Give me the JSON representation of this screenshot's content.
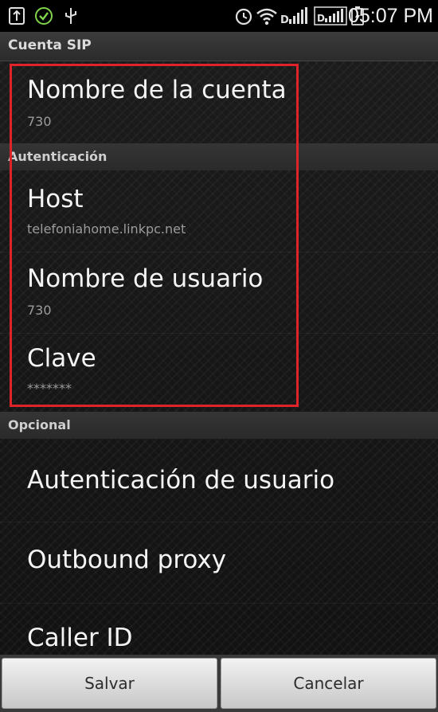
{
  "status_bar": {
    "time": "05:07 PM",
    "icons": [
      "usb-icon",
      "check-circle-icon",
      "usb-tethering-icon",
      "alarm-icon",
      "wifi-icon",
      "signal-icon",
      "signal-icon-2",
      "battery-charging-icon"
    ]
  },
  "title_bar": {
    "title": "Cuenta SIP"
  },
  "preferences": {
    "account_name": {
      "title": "Nombre de la cuenta",
      "summary": "730"
    },
    "auth_header": "Autenticación",
    "host": {
      "title": "Host",
      "summary": "telefoniahome.linkpc.net"
    },
    "username": {
      "title": "Nombre de usuario",
      "summary": "730"
    },
    "password": {
      "title": "Clave",
      "summary": "*******"
    },
    "optional_header": "Opcional",
    "user_auth": {
      "title": "Autenticación de usuario"
    },
    "outbound_proxy": {
      "title": "Outbound proxy"
    },
    "caller_id": {
      "title": "Caller ID"
    }
  },
  "buttons": {
    "save": "Salvar",
    "cancel": "Cancelar"
  },
  "colors": {
    "highlight": "#e0222a",
    "background": "#141414",
    "text_primary": "#f4f4f4",
    "text_secondary": "#9c9c9c"
  }
}
